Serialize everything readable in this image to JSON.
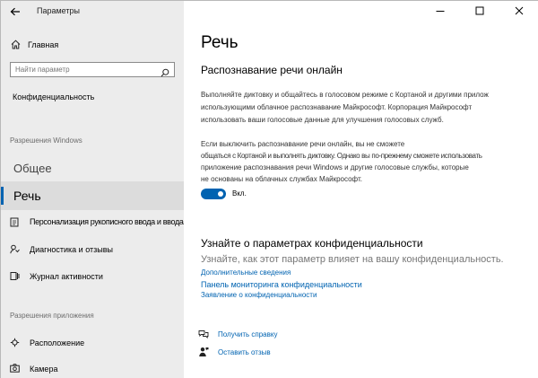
{
  "window": {
    "app_title": "Параметры",
    "minimize_glyph": "—",
    "maximize_glyph": "☐",
    "close_glyph": "✕"
  },
  "sidebar": {
    "home_label": "Главная",
    "search_placeholder": "Найти параметр",
    "category_label": "Конфиденциальность",
    "windows_permissions_header": "Разрешения Windows",
    "items": [
      {
        "label": "Общее"
      },
      {
        "label": "Речь",
        "selected": true
      },
      {
        "label": "Персонализация рукописного ввода и ввода с клавиатуры",
        "icon": "handwriting-icon"
      },
      {
        "label": "Диагностика и отзывы",
        "icon": "diagnostics-icon"
      },
      {
        "label": "Журнал активности",
        "icon": "activity-history-icon"
      }
    ],
    "app_permissions_header": "Разрешения приложения",
    "app_items": [
      {
        "label": "Расположение",
        "icon": "location-icon"
      },
      {
        "label": "Камера",
        "icon": "camera-icon"
      }
    ]
  },
  "main": {
    "title": "Речь",
    "subtitle": "Распознавание речи онлайн",
    "paragraph1": [
      "Выполняйте диктовку и общайтесь в голосовом режиме с Кортаной и другими прилож",
      "использующими облачное распознавание Майкрософт. Корпорация Майкрософт",
      "использовать ваши голосовые данные для улучшения голосовых служб."
    ],
    "paragraph2": [
      "Если выключить распознавание речи онлайн, вы не сможете",
      "общаться с Кортаной и выполнять диктовку. Однако вы по-прежнему сможете использовать",
      "приложение распознавания речи Windows и другие голосовые службы, которые",
      "не основаны на облачных службах Майкрософт."
    ],
    "toggle": {
      "state": "on",
      "label": "Вкл."
    },
    "privacy_heading": "Узнайте о параметрах конфиденциальности",
    "privacy_subheading": "Узнайте, как этот параметр влияет на вашу конфиденциальность.",
    "links": [
      "Дополнительные сведения",
      "Панель мониторинга конфиденциальности",
      "Заявление о конфиденциальности"
    ],
    "help": [
      {
        "label": "Получить справку",
        "icon": "get-help-icon"
      },
      {
        "label": "Оставить отзыв",
        "icon": "feedback-icon"
      }
    ]
  },
  "colors": {
    "accent": "#0063b1",
    "sidebar_bg": "#ececec",
    "selected_bg": "#dcdcdc"
  }
}
